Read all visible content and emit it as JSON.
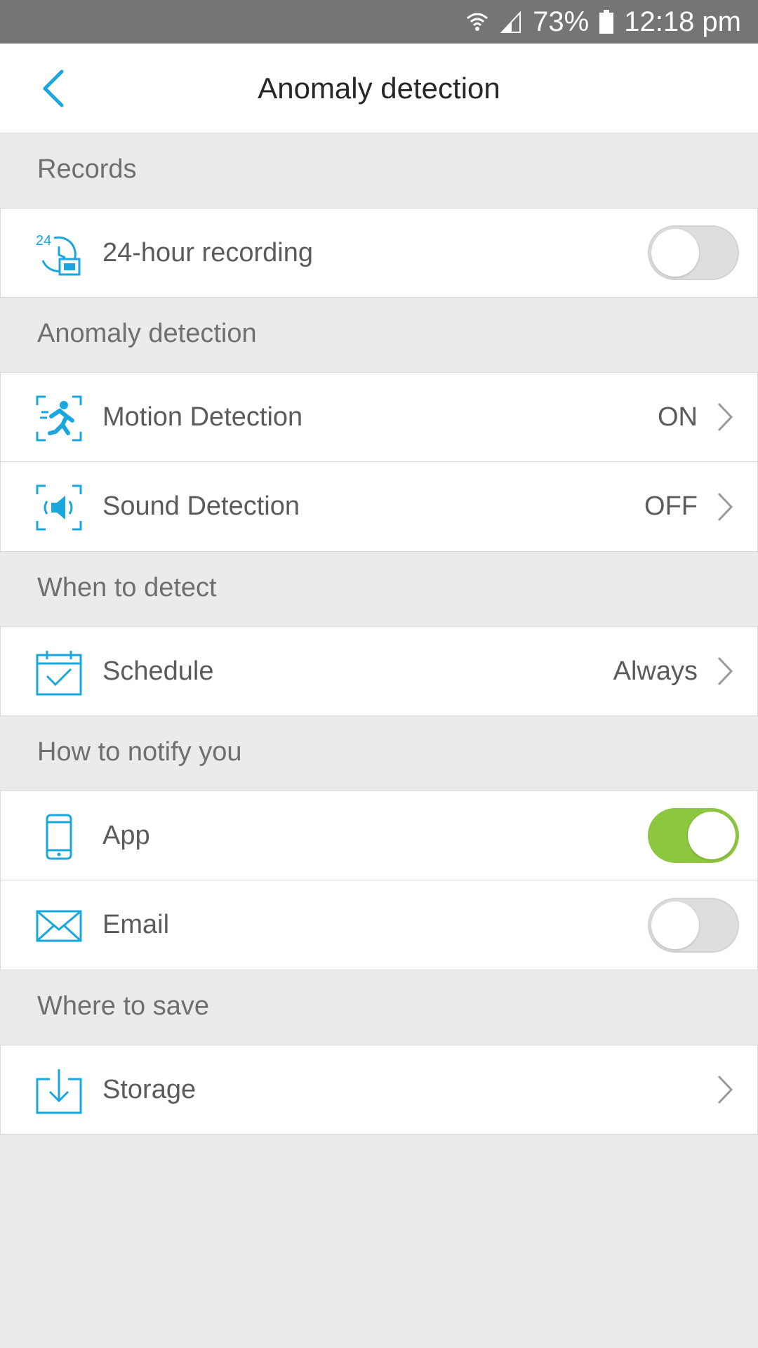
{
  "status_bar": {
    "battery": "73%",
    "time": "12:18 pm",
    "icons": [
      "wifi-icon",
      "signal-icon",
      "battery-icon"
    ]
  },
  "app_bar": {
    "title": "Anomaly detection",
    "back_icon": "chevron-left-icon"
  },
  "sections": {
    "records": {
      "header": "Records",
      "items": [
        {
          "label": "24-hour recording",
          "icon": "24-hour-recording-icon",
          "toggle": false
        }
      ]
    },
    "anomaly": {
      "header": "Anomaly detection",
      "items": [
        {
          "label": "Motion Detection",
          "value": "ON",
          "icon": "motion-detection-icon"
        },
        {
          "label": "Sound Detection",
          "value": "OFF",
          "icon": "sound-detection-icon"
        }
      ]
    },
    "when": {
      "header": "When to detect",
      "items": [
        {
          "label": "Schedule",
          "value": "Always",
          "icon": "calendar-icon"
        }
      ]
    },
    "notify": {
      "header": "How to notify you",
      "items": [
        {
          "label": "App",
          "icon": "phone-icon",
          "toggle": true
        },
        {
          "label": "Email",
          "icon": "email-icon",
          "toggle": false
        }
      ]
    },
    "save": {
      "header": "Where to save",
      "items": [
        {
          "label": "Storage",
          "icon": "download-icon"
        }
      ]
    }
  },
  "colors": {
    "accent": "#1aa7e0",
    "toggle_on": "#8dc63f",
    "toggle_off": "#dedede",
    "status_bar": "#757575"
  }
}
